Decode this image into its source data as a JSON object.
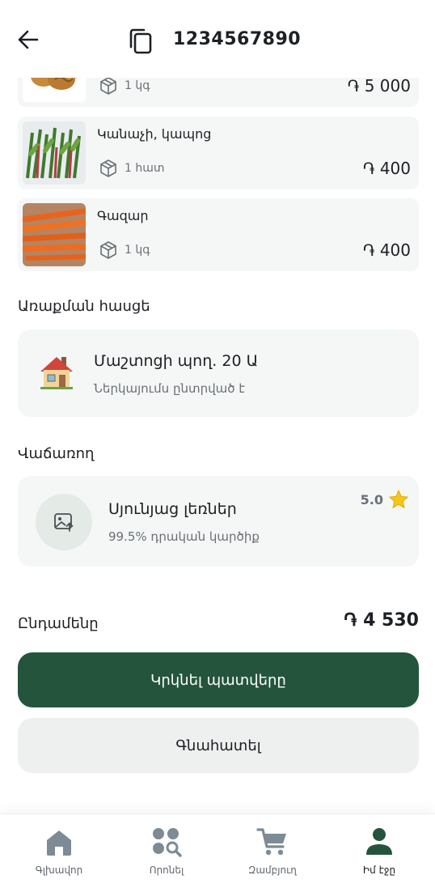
{
  "header": {
    "order_id": "1234567890",
    "back_icon": "arrow-left-icon",
    "copy_icon": "copy-icon"
  },
  "products": [
    {
      "name": "",
      "qty": "1 կգ",
      "price": "֏ 5 000",
      "image": "walnuts"
    },
    {
      "name": "Կանաչի, կապոց",
      "qty": "1 հատ",
      "price": "֏ 400",
      "image": "greens"
    },
    {
      "name": "Գազար",
      "qty": "1 կգ",
      "price": "֏ 400",
      "image": "carrots"
    }
  ],
  "delivery": {
    "section_title": "Առաքման հասցե",
    "address": "Մաշտոցի պող. 20 Ա",
    "note": "Ներկայումս ընտրված է"
  },
  "seller": {
    "section_title": "Վաճառող",
    "name": "Սյունյաց լեռներ",
    "feedback": "99.5% դրական կարծիք",
    "rating": "5.0"
  },
  "summary": {
    "total_label": "Ընդամենը",
    "total_value": "֏ 4 530"
  },
  "actions": {
    "repeat_label": "Կրկնել պատվերը",
    "rate_label": "Գնահատել"
  },
  "nav": [
    {
      "label": "Գլխավոր",
      "icon": "home-icon"
    },
    {
      "label": "Որոնել",
      "icon": "search-categories-icon"
    },
    {
      "label": "Զամբյուղ",
      "icon": "cart-icon"
    },
    {
      "label": "Իմ էջը",
      "icon": "profile-icon"
    }
  ],
  "colors": {
    "primary": "#24553c",
    "card_bg": "#f4f7f6",
    "muted_text": "#6b7076",
    "nav_icon": "#7c8b96",
    "star": "#f5c518"
  }
}
